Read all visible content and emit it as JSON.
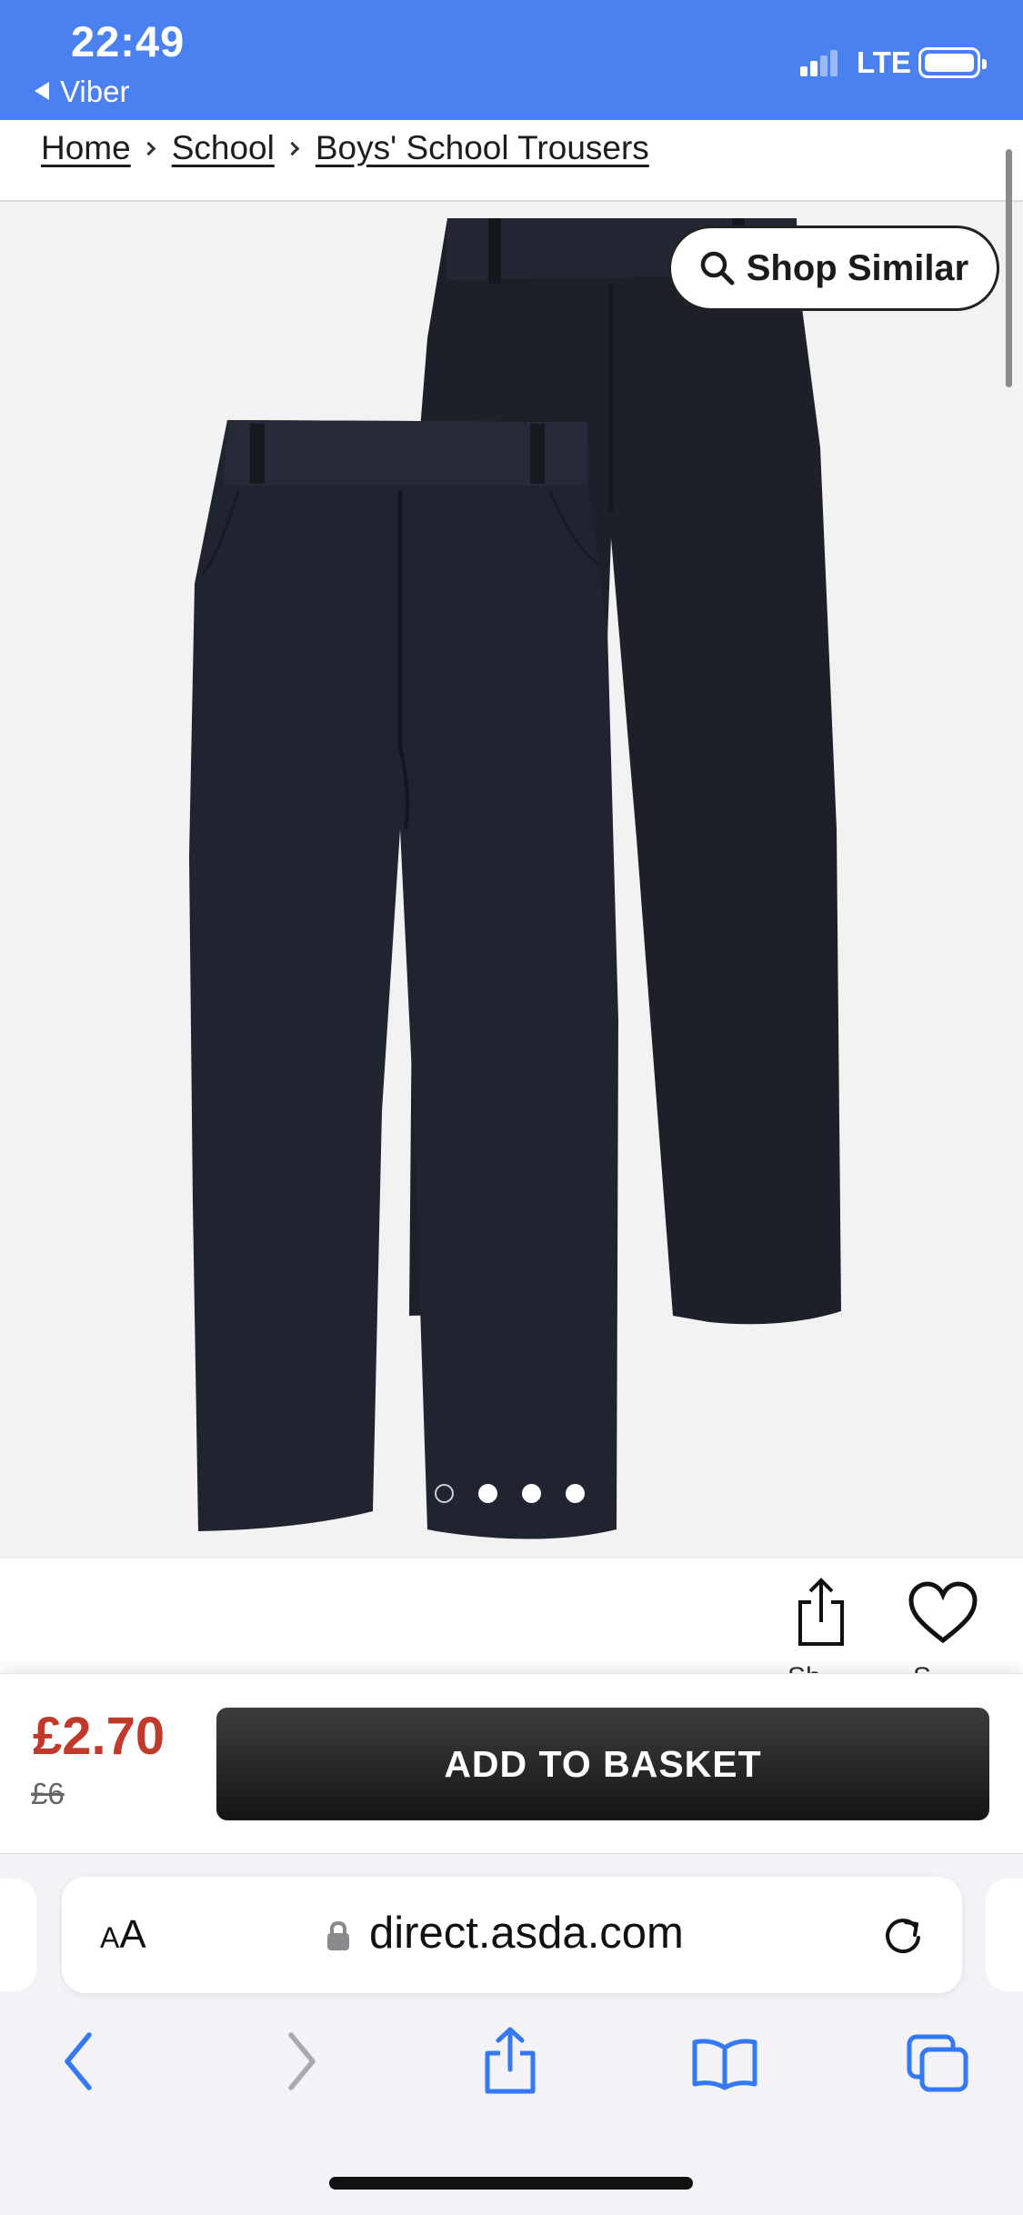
{
  "status_bar": {
    "time": "22:49",
    "back_app": "Viber",
    "network": "LTE",
    "background": "#4a80f0"
  },
  "breadcrumb": {
    "items": [
      "Home",
      "School",
      "Boys' School Trousers"
    ]
  },
  "product": {
    "image_alt": "Black boys' school trousers, two pack",
    "shop_similar_label": "Shop Similar",
    "carousel": {
      "count": 4,
      "active_index": 0
    }
  },
  "actions": {
    "share_label": "Sh",
    "save_label": "S"
  },
  "purchase": {
    "price_now": "£2.70",
    "price_was": "£6",
    "add_to_basket_label": "ADD TO BASKET",
    "price_color": "#c0392b"
  },
  "browser": {
    "text_size_label": "AA",
    "url": "direct.asda.com"
  },
  "icons": {
    "signal": "signal-icon",
    "battery": "battery-icon",
    "search": "search-icon",
    "share": "share-icon",
    "heart": "heart-icon",
    "lock": "lock-icon",
    "reload": "reload-icon",
    "back": "chevron-left-icon",
    "forward": "chevron-right-icon",
    "bookmarks": "book-icon",
    "tabs": "tabs-icon"
  }
}
